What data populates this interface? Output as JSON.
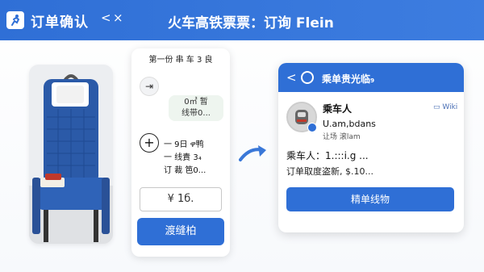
{
  "header": {
    "app_title": "订单确认",
    "back_glyph": "<",
    "close_glyph": "×",
    "main_title": "火车高铁票票：订询 Flein"
  },
  "seat": {
    "image": "blue-train-seat-photo"
  },
  "middle": {
    "title": "第一份 串 车 3 良",
    "arrow_glyph": "⇥",
    "badge_line1": "0㎡ 暂",
    "badge_line2": "线带0...",
    "plus_glyph": "+",
    "line1": "一 9日 ዋ鸭",
    "line2": "一 线責 3₄",
    "line3": "订 裁 笆0...",
    "price": "¥ 1б.",
    "button": "渡缝柏"
  },
  "right": {
    "back_glyph": "<",
    "title": "乘单贵光临₉",
    "name": "乘车人",
    "identity": "U.am,bdans",
    "sub": "让场 滚lam",
    "device_label": "Wiki",
    "passenger": "乘车人：1.:::i.g ...",
    "amount": "订单取度盗新, $.10...",
    "button": "精单线物"
  },
  "colors": {
    "primary": "#2f6fd6",
    "white": "#ffffff"
  }
}
